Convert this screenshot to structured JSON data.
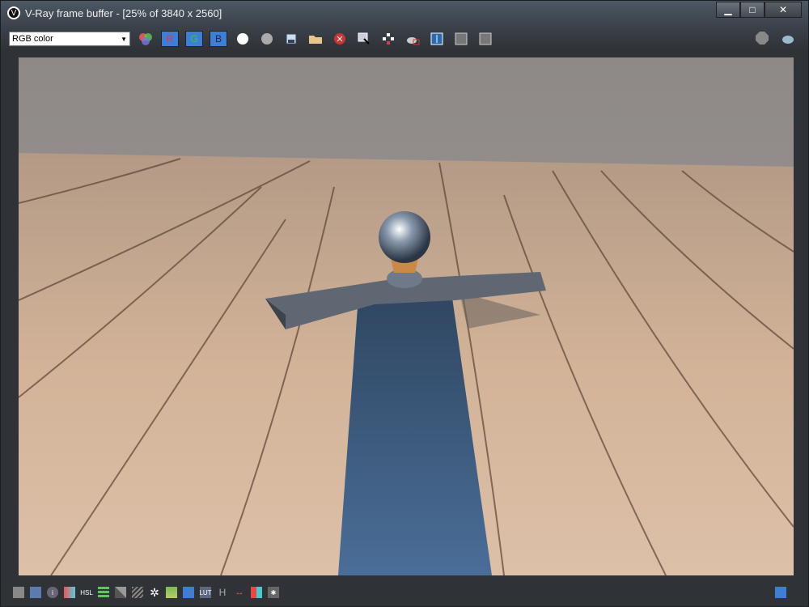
{
  "window": {
    "title": "V-Ray frame buffer - [25% of 3840 x 2560]",
    "minimize": "▁",
    "maximize": "□",
    "close": "✕"
  },
  "toolbar": {
    "channel_select": "RGB color",
    "r": "R",
    "g": "G",
    "b": "B",
    "icons": [
      "color-channels-icon",
      "white-circle-icon",
      "gray-circle-icon",
      "save-icon",
      "open-folder-icon",
      "clear-icon",
      "region-icon",
      "track-mouse-icon",
      "render-teapot-icon",
      "compare-icon",
      "ab-horizontal-icon",
      "ab-vertical-icon"
    ]
  },
  "toolbar_right": [
    "stop-icon",
    "render-icon"
  ],
  "bottom": {
    "icons": [
      "display-icon",
      "color-correction-icon",
      "info-icon",
      "exposure-icon",
      "hsl-icon",
      "levels-icon",
      "curve-icon",
      "background-icon",
      "lens-effects-icon",
      "image-icon",
      "srgb-icon",
      "lut-icon",
      "h-icon",
      "stereo-icon",
      "color-bars-icon",
      "pixel-icon"
    ],
    "hsl": "HSL",
    "lut": "LUT",
    "h": "H"
  },
  "colors": {
    "accent": "#3d7fd6",
    "blade": "#3e5e84",
    "wood": "#c9a888",
    "sky": "#8f8a88"
  }
}
